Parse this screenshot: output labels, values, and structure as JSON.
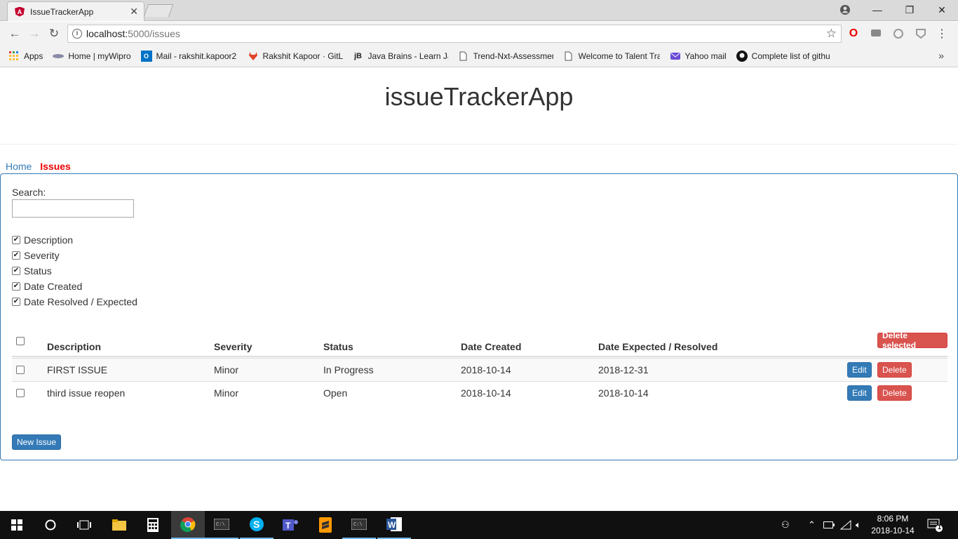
{
  "browser": {
    "tab_title": "IssueTrackerApp",
    "url_host": "localhost:",
    "url_path": "5000/issues",
    "bookmarks": [
      {
        "label": "Apps",
        "icon": "apps-grid-icon"
      },
      {
        "label": "Home | myWipro",
        "icon": "wipro-icon"
      },
      {
        "label": "Mail - rakshit.kapoor2",
        "icon": "outlook-icon"
      },
      {
        "label": "Rakshit Kapoor · GitLa",
        "icon": "gitlab-icon"
      },
      {
        "label": "Java Brains - Learn Ja",
        "icon": "jb-icon"
      },
      {
        "label": "Trend-Nxt-Assessmer",
        "icon": "page-icon"
      },
      {
        "label": "Welcome to Talent Tra",
        "icon": "page-icon"
      },
      {
        "label": "Yahoo mail",
        "icon": "yahoo-mail-icon"
      },
      {
        "label": "Complete list of githu",
        "icon": "github-icon"
      }
    ]
  },
  "app": {
    "title": "issueTrackerApp",
    "nav": {
      "home": "Home",
      "issues": "Issues"
    },
    "search": {
      "label": "Search:",
      "value": ""
    },
    "columns_toggle": [
      {
        "label": "Description",
        "checked": true
      },
      {
        "label": "Severity",
        "checked": true
      },
      {
        "label": "Status",
        "checked": true
      },
      {
        "label": "Date Created",
        "checked": true
      },
      {
        "label": "Date Resolved / Expected",
        "checked": true
      }
    ],
    "table": {
      "headers": {
        "description": "Description",
        "severity": "Severity",
        "status": "Status",
        "created": "Date Created",
        "expected": "Date Expected / Resolved"
      },
      "delete_selected": "Delete selected",
      "rows": [
        {
          "description": "FIRST ISSUE",
          "severity": "Minor",
          "status": "In Progress",
          "created": "2018-10-14",
          "expected": "2018-12-31",
          "edit": "Edit",
          "delete": "Delete"
        },
        {
          "description": "third issue reopen",
          "severity": "Minor",
          "status": "Open",
          "created": "2018-10-14",
          "expected": "2018-10-14",
          "edit": "Edit",
          "delete": "Delete"
        }
      ]
    },
    "new_issue": "New Issue"
  },
  "taskbar": {
    "time": "8:06 PM",
    "date": "2018-10-14",
    "notification_count": "1"
  },
  "colors": {
    "link": "#337ab7",
    "active_nav": "#e00000",
    "primary": "#337ab7",
    "danger": "#d9534f"
  }
}
